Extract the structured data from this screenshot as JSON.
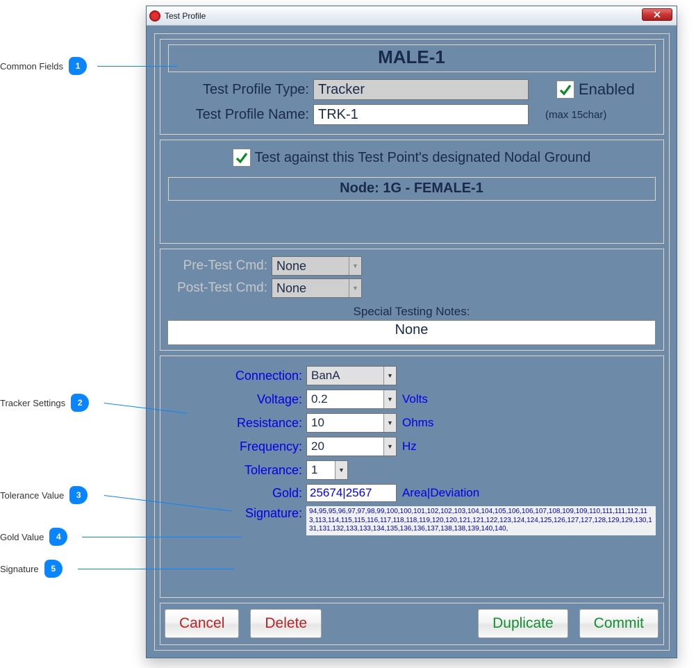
{
  "callouts": {
    "c1": "Common  Fields",
    "c2": "Tracker Settings",
    "c3": "Tolerance Value",
    "c4": "Gold Value",
    "c5": "Signature"
  },
  "window": {
    "title": "Test Profile"
  },
  "header": {
    "heading": "MALE-1",
    "type_label": "Test Profile Type:",
    "type_value": "Tracker",
    "enabled_label": "Enabled",
    "name_label": "Test Profile Name:",
    "name_value": "TRK-1",
    "name_hint": "(max 15char)"
  },
  "nodal": {
    "text": "Test against this Test Point's designated Nodal Ground",
    "node_bar": "Node: 1G - FEMALE-1"
  },
  "cmds": {
    "pre_label": "Pre-Test Cmd:",
    "pre_value": "None",
    "post_label": "Post-Test Cmd:",
    "post_value": "None",
    "notes_label": "Special Testing Notes:",
    "notes_value": "None"
  },
  "tracker": {
    "connection_label": "Connection:",
    "connection_value": "BanA",
    "voltage_label": "Voltage:",
    "voltage_value": "0.2",
    "voltage_unit": "Volts",
    "resistance_label": "Resistance:",
    "resistance_value": "10",
    "resistance_unit": "Ohms",
    "frequency_label": "Frequency:",
    "frequency_value": "20",
    "frequency_unit": "Hz",
    "tolerance_label": "Tolerance:",
    "tolerance_value": "1",
    "gold_label": "Gold:",
    "gold_value": "25674|2567",
    "gold_unit": "Area|Deviation",
    "signature_label": "Signature:",
    "signature_value": "94,95,95,96,97,97,98,99,100,100,101,102,102,103,104,104,105,106,106,107,108,109,109,110,111,111,112,113,113,114,115,115,116,117,118,118,119,120,120,121,121,122,123,124,124,125,126,127,127,128,129,129,130,131,131,132,133,133,134,135,136,136,137,138,138,139,140,140,"
  },
  "buttons": {
    "cancel": "Cancel",
    "delete": "Delete",
    "duplicate": "Duplicate",
    "commit": "Commit"
  }
}
